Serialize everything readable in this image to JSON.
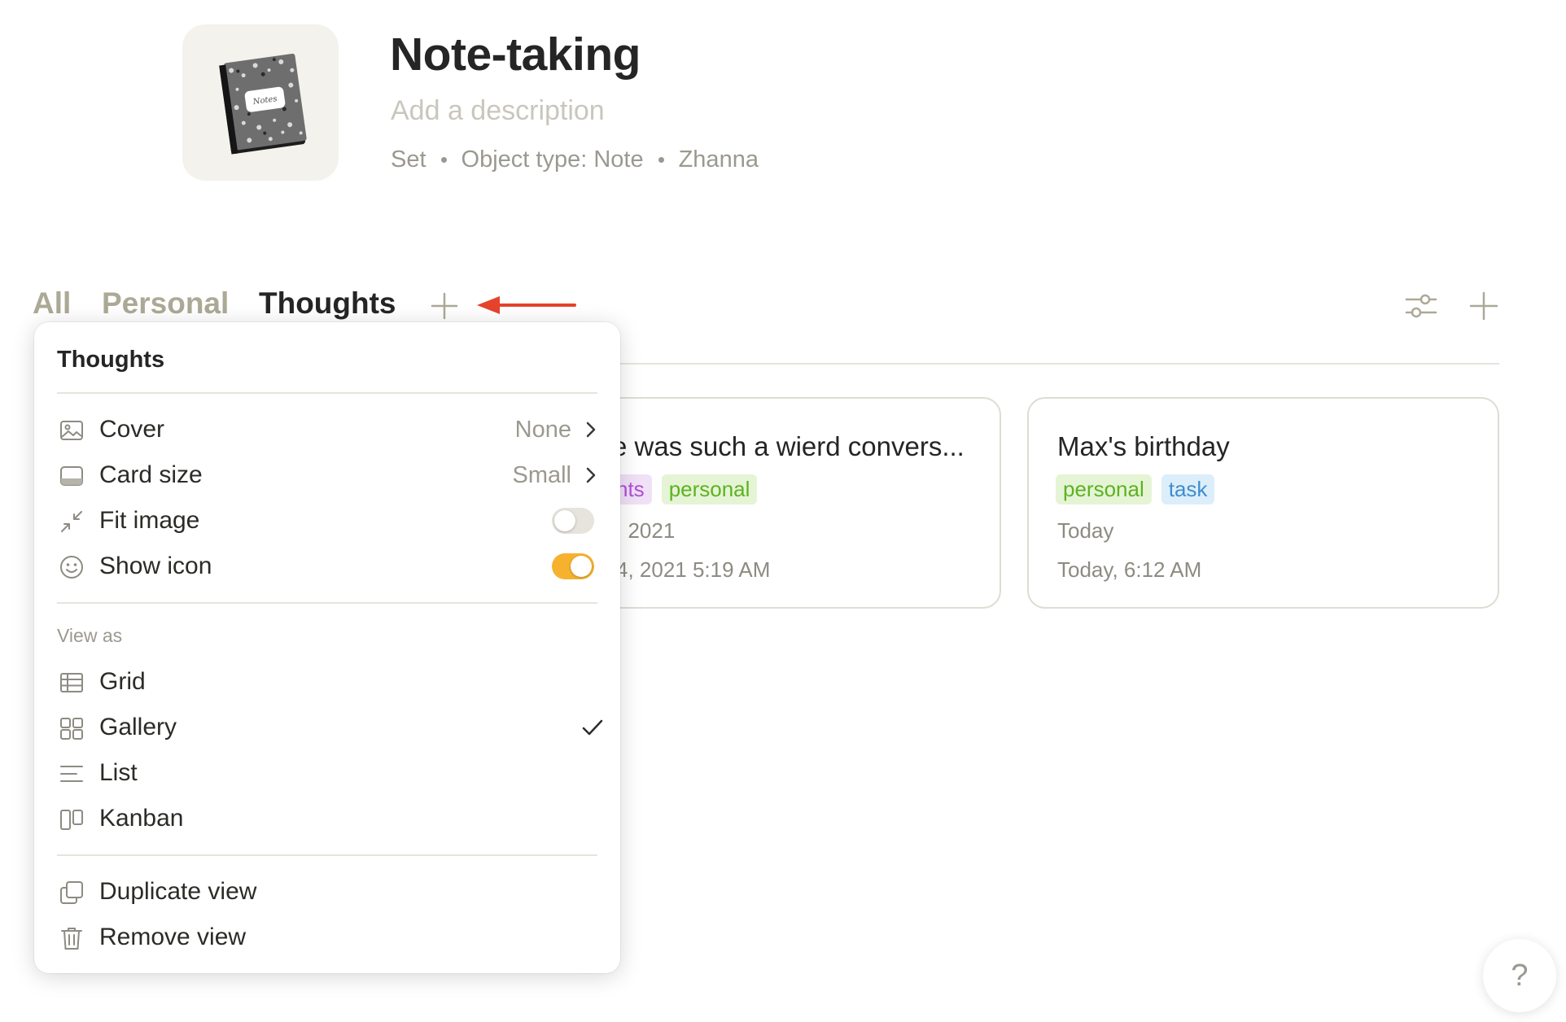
{
  "header": {
    "title": "Note-taking",
    "description_placeholder": "Add a description",
    "meta": [
      "Set",
      "Object type: Note",
      "Zhanna"
    ]
  },
  "tabs": [
    {
      "label": "All",
      "active": false
    },
    {
      "label": "Personal",
      "active": false
    },
    {
      "label": "Thoughts",
      "active": true
    }
  ],
  "cards": [
    {
      "title": "e was such a wierd convers...",
      "tags": [
        "hts",
        "personal"
      ],
      "dates": [
        ", 2021",
        "4, 2021 5:19 AM"
      ]
    },
    {
      "title": "Max's birthday",
      "tags": [
        "personal",
        "task"
      ],
      "dates": [
        "Today",
        "Today, 6:12 AM"
      ]
    }
  ],
  "view_menu": {
    "title": "Thoughts",
    "settings": [
      {
        "label": "Cover",
        "value": "None"
      },
      {
        "label": "Card size",
        "value": "Small"
      },
      {
        "label": "Fit image",
        "toggle": false
      },
      {
        "label": "Show icon",
        "toggle": true
      }
    ],
    "view_as_label": "View as",
    "view_types": [
      {
        "label": "Grid",
        "selected": false
      },
      {
        "label": "Gallery",
        "selected": true
      },
      {
        "label": "List",
        "selected": false
      },
      {
        "label": "Kanban",
        "selected": false
      }
    ],
    "actions": [
      {
        "label": "Duplicate view"
      },
      {
        "label": "Remove view"
      }
    ]
  },
  "help_label": "?",
  "colors": {
    "accent_toggle": "#f6b22f",
    "annotation_arrow": "#e5432c",
    "tab_inactive": "#aca996",
    "tag_personal": "#5cb321",
    "tag_task": "#3e8ecf",
    "tag_thoughts": "#b04fd8"
  },
  "icons": [
    "notebook-icon",
    "filter-settings-icon",
    "add-icon",
    "image-icon",
    "card-size-icon",
    "collapse-arrows-icon",
    "smiley-icon",
    "table-icon",
    "gallery-grid-icon",
    "list-lines-icon",
    "kanban-columns-icon",
    "duplicate-icon",
    "trash-icon",
    "chevron-right-icon",
    "checkmark-icon",
    "arrow-annotation"
  ]
}
